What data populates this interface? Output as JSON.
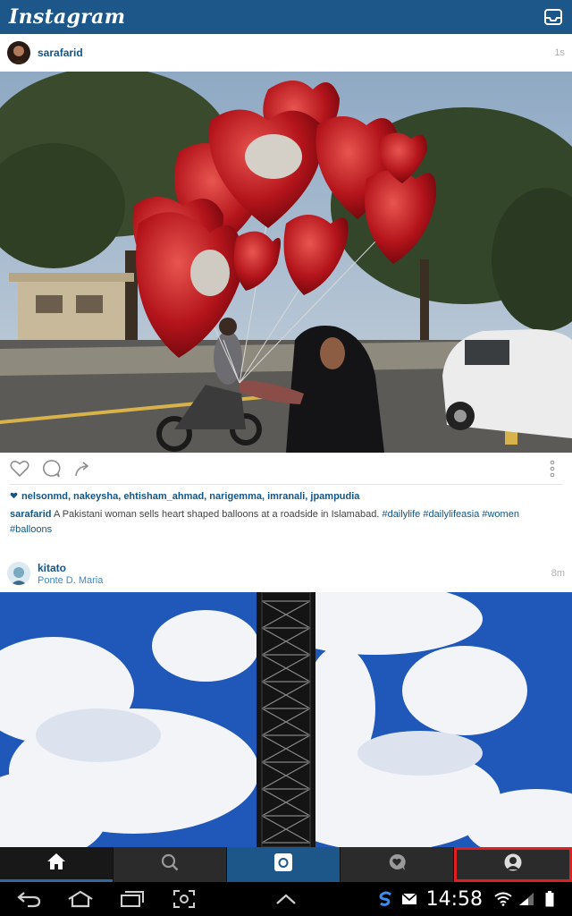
{
  "app": {
    "title": "Instagram"
  },
  "posts": [
    {
      "username": "sarafarid",
      "time": "1s",
      "likes": "nelsonmd, nakeysha, ehtisham_ahmad, narigemma, imranali, jpampudia",
      "caption": {
        "user": "sarafarid",
        "text": "A Pakistani woman sells heart shaped balloons at a roadside in Islamabad.",
        "tags": [
          "#dailylife",
          "#dailylifeasia",
          "#women",
          "#balloons"
        ]
      }
    },
    {
      "username": "kitato",
      "location": "Ponte D. Maria",
      "time": "8m"
    }
  ],
  "tabs": [
    "home",
    "search",
    "camera",
    "activity",
    "profile"
  ],
  "status": {
    "time": "14:58"
  },
  "colors": {
    "header": "#1d5689",
    "link": "#125688",
    "highlight": "#e02020"
  },
  "icons": {
    "inbox": "inbox-icon",
    "like": "heart-outline-icon",
    "comment": "comment-icon",
    "share": "share-arrow-icon",
    "more": "more-vertical-icon"
  }
}
